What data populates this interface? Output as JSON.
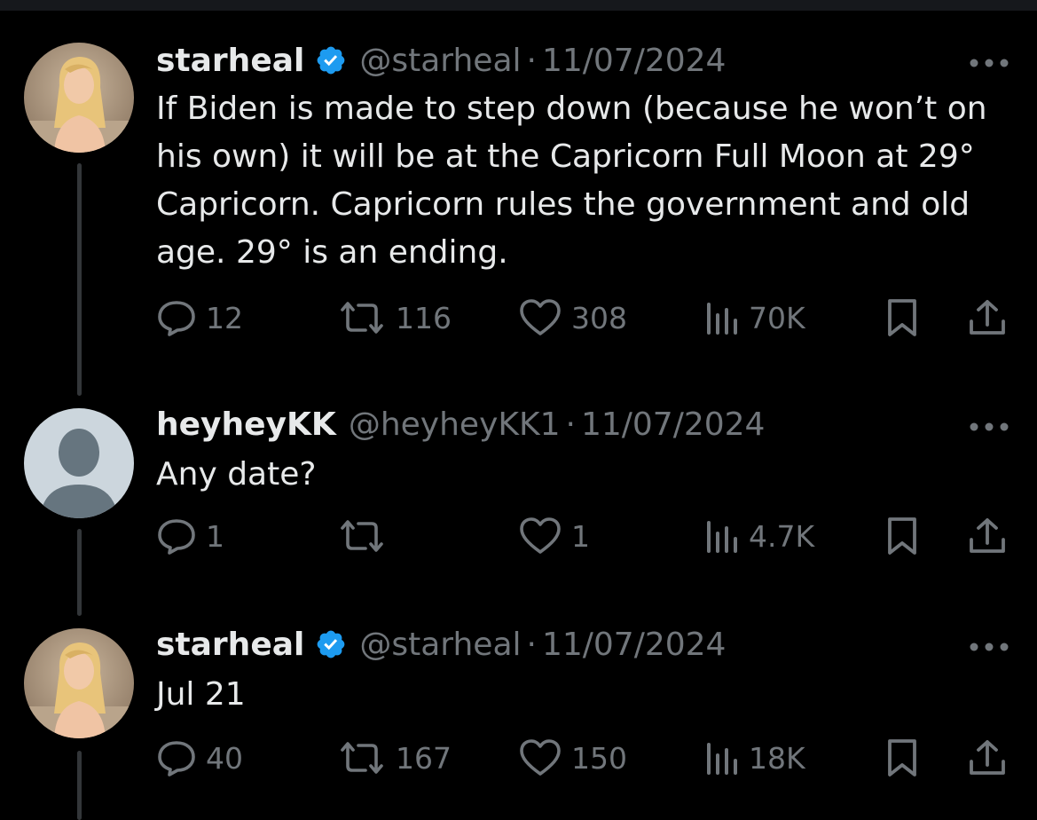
{
  "tweets": [
    {
      "name": "starheal",
      "verified": true,
      "handle": "@starheal",
      "separator": "·",
      "date": "11/07/2024",
      "text": "If Biden is made to step down (because he won’t on his own) it will be at the Capricorn Full Moon at 29° Capricorn. Capricorn rules the government and old age. 29° is an ending.",
      "replies": "12",
      "retweets": "116",
      "likes": "308",
      "views": "70K"
    },
    {
      "name": "heyheyKK",
      "verified": false,
      "handle": "@heyheyKK1",
      "separator": "·",
      "date": "11/07/2024",
      "text": "Any date?",
      "replies": "1",
      "retweets": "",
      "likes": "1",
      "views": "4.7K"
    },
    {
      "name": "starheal",
      "verified": true,
      "handle": "@starheal",
      "separator": "·",
      "date": "11/07/2024",
      "text": "Jul 21",
      "replies": "40",
      "retweets": "167",
      "likes": "150",
      "views": "18K"
    }
  ],
  "icons": {
    "reply": "speech-bubble-icon",
    "retweet": "retweet-arrows-icon",
    "like": "heart-icon",
    "views": "bar-chart-icon",
    "bookmark": "bookmark-icon",
    "share": "share-upload-icon",
    "more": "ellipsis-icon",
    "verified": "verified-badge-icon"
  },
  "colors": {
    "background": "#000000",
    "primary_text": "#e7e9ea",
    "secondary_text": "#71767b",
    "verified_badge": "#1d9bf0",
    "thread_line": "#333639"
  }
}
